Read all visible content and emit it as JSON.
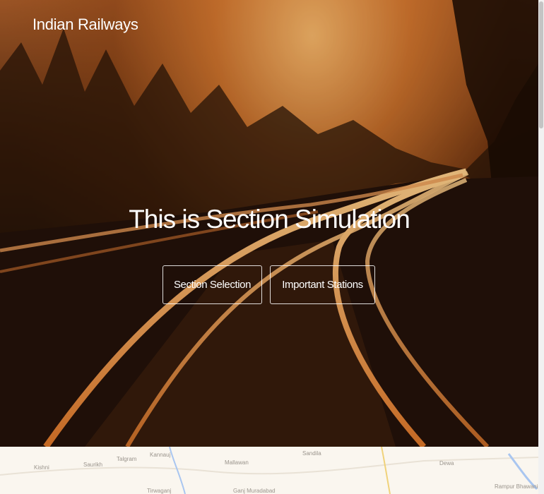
{
  "brand": {
    "title": "Indian Railways"
  },
  "hero": {
    "headline": "This is Section Simulation",
    "buttons": [
      {
        "label": "Section Selection"
      },
      {
        "label": "Important Stations"
      }
    ]
  },
  "map": {
    "places": [
      "Kishni",
      "Saurikh",
      "Talgram",
      "Kannauj",
      "Mallawan",
      "Sandila",
      "Dewa",
      "Tirwaganj",
      "Ganj Muradabad",
      "Rampur Bhawanipur"
    ]
  },
  "colors": {
    "accent": "#ffffff",
    "sky": "#e8a060",
    "map_background": "#faf6ef"
  }
}
